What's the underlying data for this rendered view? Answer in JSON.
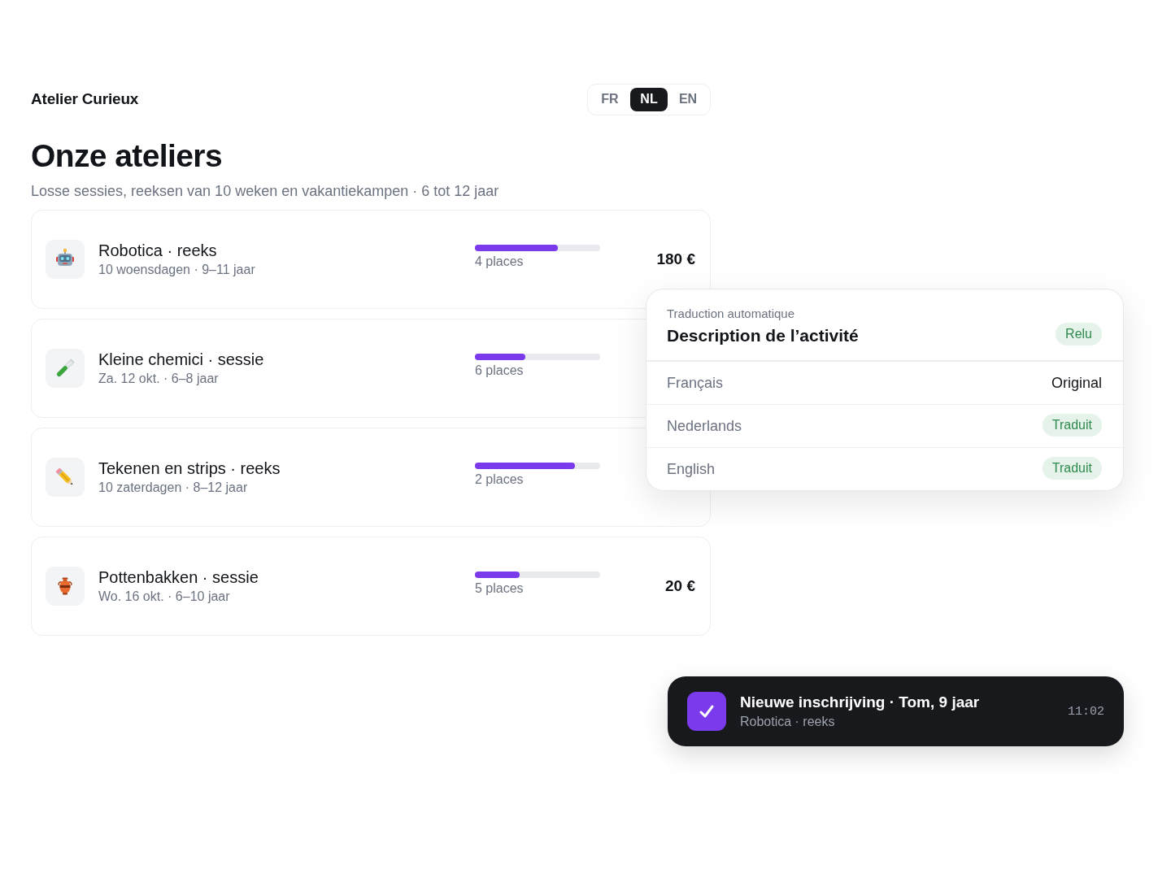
{
  "brand": "Atelier Curieux",
  "language_switcher": [
    {
      "label": "FR",
      "selected": false
    },
    {
      "label": "NL",
      "selected": true
    },
    {
      "label": "EN",
      "selected": false
    }
  ],
  "page": {
    "title": "Onze ateliers",
    "subtitle": "Losse sessies, reeksen van 10 weken en vakantiekampen · 6 tot 12 jaar"
  },
  "workshops": [
    {
      "title": "Robotica · reeks",
      "details": "10 woensdagen · 9–11 jaar",
      "level": 0.66,
      "places": "4 places",
      "price": "180 €"
    },
    {
      "title": "Kleine chemici · sessie",
      "details": "Za. 12 okt. · 6–8 jaar",
      "level": 0.4,
      "places": "6 places"
    },
    {
      "title": "Tekenen en strips · reeks",
      "details": "10 zaterdagen · 8–12 jaar",
      "level": 0.8,
      "places": "2 places"
    },
    {
      "title": "Pottenbakken · sessie",
      "details": "Wo. 16 okt. · 6–10 jaar",
      "level": 0.36,
      "places": "5 places",
      "price": "20 €"
    }
  ],
  "translation_panel": {
    "caption": "Traduction automatique",
    "title": "Description de l’activité",
    "status": "Relu",
    "languages": [
      {
        "name": "Français",
        "status": "Original",
        "kind": "plain"
      },
      {
        "name": "Nederlands",
        "status": "Traduit",
        "kind": "tag"
      },
      {
        "name": "English",
        "status": "Traduit",
        "kind": "tag"
      }
    ]
  },
  "notification": {
    "title": "Nieuwe inschrijving · Tom, 9 jaar",
    "subtitle": "Robotica · reeks",
    "time": "11:02"
  }
}
